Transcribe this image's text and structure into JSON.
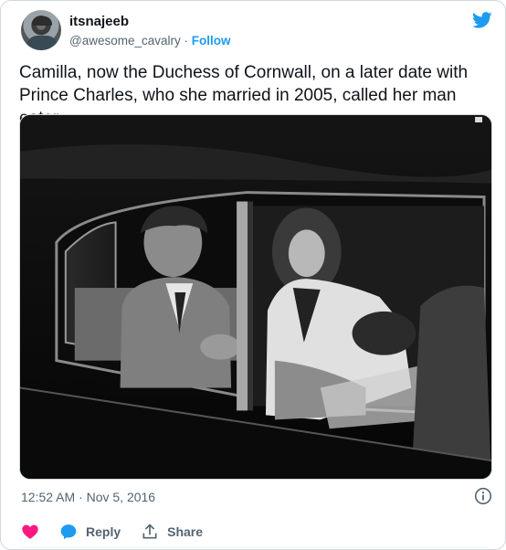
{
  "author": {
    "display_name": "itsnajeeb",
    "handle": "@awesome_cavalry",
    "separator": "·",
    "follow_label": "Follow"
  },
  "tweet": {
    "text": "Camilla, now the Duchess of Cornwall, on a later date with Prince Charles, who she married in 2005, called her man eater",
    "timestamp": "12:52 AM · Nov 5, 2016"
  },
  "actions": {
    "reply_label": "Reply",
    "share_label": "Share"
  },
  "colors": {
    "accent": "#1d9bf0",
    "like": "#f91880",
    "secondary_text": "#536471"
  },
  "icons": [
    "twitter-bird-icon",
    "info-icon",
    "heart-icon",
    "reply-bubble-icon",
    "share-icon"
  ]
}
